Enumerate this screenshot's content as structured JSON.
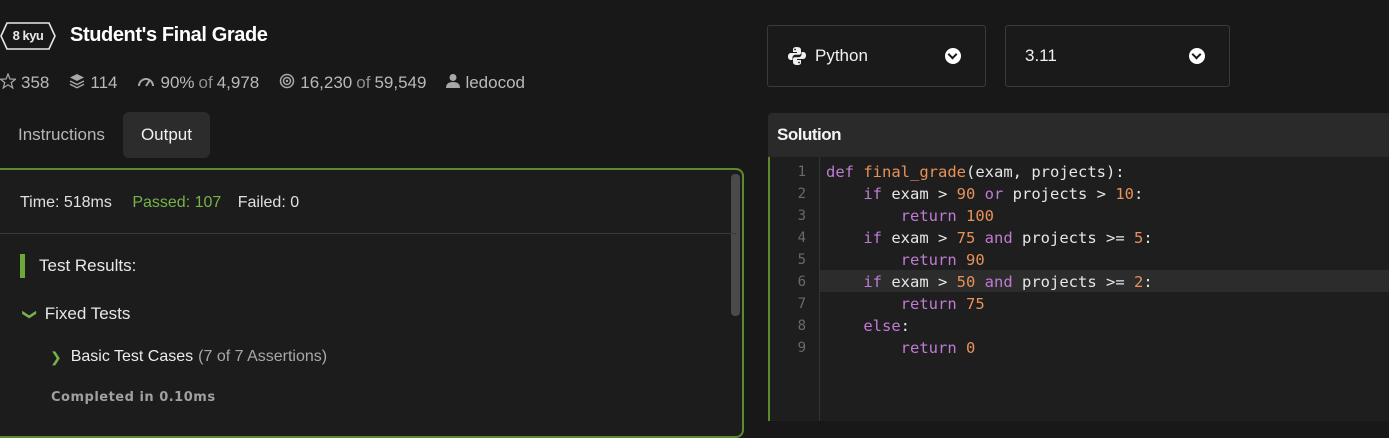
{
  "kata": {
    "rank": "8 kyu",
    "title": "Student's Final Grade"
  },
  "stats": {
    "stars": "358",
    "collections": "114",
    "satisfaction": "90%",
    "satisfaction_of": "of",
    "votes": "4,978",
    "completed": "16,230",
    "completed_of": "of",
    "attempts": "59,549",
    "author": "ledocod"
  },
  "tabs": [
    {
      "label": "Instructions"
    },
    {
      "label": "Output"
    }
  ],
  "output": {
    "time": "Time: 518ms",
    "passed": "Passed: 107",
    "failed": "Failed: 0",
    "results_header": "Test Results:",
    "group": "Fixed Tests",
    "test_case": "Basic Test Cases",
    "assertions": "(7 of 7 Assertions)",
    "completed_in": "Completed in 0.10ms"
  },
  "language_select": {
    "value": "Python",
    "icon": "python-icon"
  },
  "version_select": {
    "value": "3.11"
  },
  "solution": {
    "header": "Solution",
    "line_numbers": [
      "1",
      "2",
      "3",
      "4",
      "5",
      "6",
      "7",
      "8",
      "9"
    ]
  },
  "colors": {
    "accent_green": "#77b24a",
    "keyword": "#bf7bd4",
    "number": "#e8915a"
  }
}
